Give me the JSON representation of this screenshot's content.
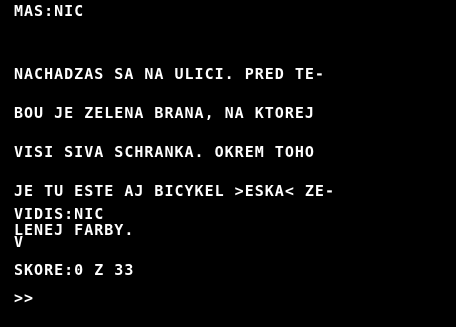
{
  "game": {
    "inventory_line": "MAS:NIC",
    "description_lines": [
      "NACHADZAS SA NA ULICI. PRED TE-",
      "BOU JE ZELENA BRANA, NA KTOREJ",
      "VISI SIVA SCHRANKA. OKREM TOHO",
      "JE TU ESTE AJ BICYKEL >ESKA< ZE-",
      "LENEJ FARBY."
    ],
    "visible_items_line": "VIDIS:NIC",
    "exits_line": "V",
    "score_line": "SKORE:0 Z 33",
    "prompt": ">>"
  },
  "colors": {
    "background": "#000000",
    "text": "#ffffff"
  }
}
